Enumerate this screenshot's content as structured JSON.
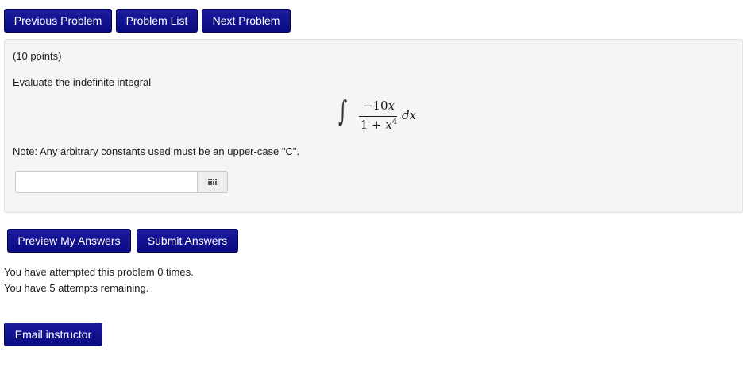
{
  "nav": {
    "previous_label": "Previous Problem",
    "list_label": "Problem List",
    "next_label": "Next Problem"
  },
  "problem": {
    "points": "(10 points)",
    "prompt": "Evaluate the indefinite integral",
    "integral": {
      "symbol": "∫",
      "numerator_coeff": "−10",
      "numerator_var": "x",
      "denominator_const": "1 + ",
      "denominator_var": "x",
      "denominator_exp": "4",
      "differential": "dx"
    },
    "note": "Note: Any arbitrary constants used must be an upper-case \"C\".",
    "answer_value": "",
    "answer_placeholder": "",
    "equation_editor_icon": "grid-icon"
  },
  "actions": {
    "preview_label": "Preview My Answers",
    "submit_label": "Submit Answers"
  },
  "status": {
    "attempted": "You have attempted this problem 0 times.",
    "remaining": "You have 5 attempts remaining."
  },
  "footer": {
    "email_label": "Email instructor"
  },
  "colors": {
    "button_bg": "#0a0a82",
    "button_text": "#ffffff",
    "panel_bg": "#f5f5f5"
  }
}
